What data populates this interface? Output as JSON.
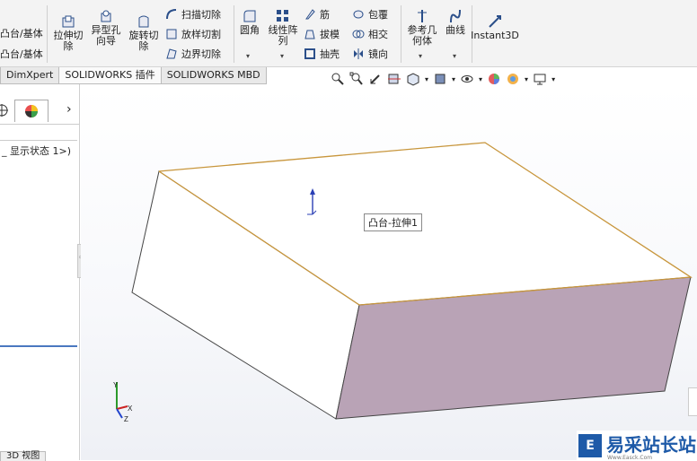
{
  "ribbon": {
    "left_items": [
      "凸台/基体",
      "凸台/基体"
    ],
    "extrude_cut": "拉伸切\n除",
    "hole_wizard": "异型孔\n向导",
    "revolve_cut": "旋转切\n除",
    "sweep_cut": "扫描切除",
    "loft_cut": "放样切割",
    "boundary_cut": "边界切除",
    "fillet": "圆角",
    "linear_pattern": "线性阵\n列",
    "rib": "筋",
    "draft": "拔模",
    "shell": "抽壳",
    "wrap": "包覆",
    "intersect": "相交",
    "mirror": "镜向",
    "ref_geometry": "参考几\n何体",
    "curves": "曲线",
    "instant3d": "Instant3D"
  },
  "tabs": [
    "DimXpert",
    "SOLIDWORKS 插件",
    "SOLIDWORKS MBD"
  ],
  "panel": {
    "tree_item": "_ 显示状态 1>)",
    "expand_glyph": "›"
  },
  "viewport": {
    "feature_callout": "凸台-拉伸1",
    "triad_labels": [
      "Y",
      "X",
      "Z"
    ]
  },
  "bottom_tab": "3D 视图",
  "watermark": {
    "text": "易采站长站",
    "subtext": "Www.Easck.Com"
  },
  "colors": {
    "top_face": "#ffffff",
    "side_face": "#b9a3b6",
    "edge_highlight": "#c8963c"
  }
}
